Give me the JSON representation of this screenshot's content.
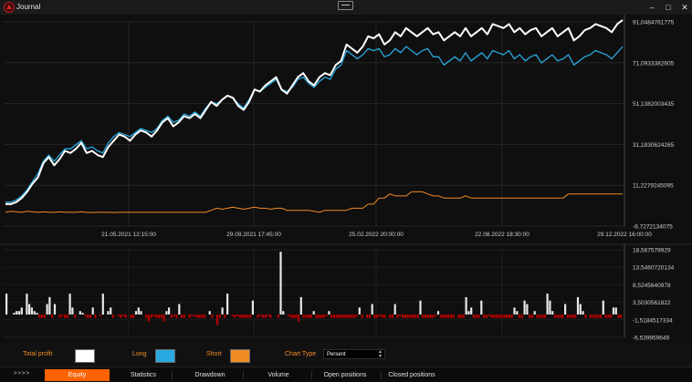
{
  "window": {
    "title": "Journal",
    "icon": "app-logo-icon",
    "controls": [
      "minimize-icon",
      "maximize-icon",
      "close-icon"
    ],
    "minimize_glyph": "–",
    "maximize_glyph": "□",
    "close_glyph": "✕"
  },
  "colors": {
    "background": "#0f0f0f",
    "total_profit": "#ffffff",
    "long": "#29a9e1",
    "short": "#f08b24",
    "volume_positive": "#e8e8e8",
    "volume_negative": "#b00000",
    "active_tab": "#ff6200"
  },
  "chart_data": [
    {
      "type": "line",
      "x_tick_labels": [
        "21.05.2021 12:15:00",
        "29.09.2021 17:45:00",
        "25.02.2022 20:00:00",
        "22.08.2022 18:30:00",
        "29.12.2022 16:00:00"
      ],
      "y_tick_labels": [
        "91,0484761775",
        "71,0933382605",
        "51,1382003435",
        "31,1830624265",
        "11,2279245095",
        "-8,7272134075"
      ],
      "ylim": [
        -8.7272134075,
        91.0484761775
      ],
      "grid": true,
      "series": [
        {
          "name": "Total profit",
          "color": "#ffffff",
          "values": [
            2,
            2,
            3,
            5,
            8,
            12,
            15,
            22,
            25,
            21,
            24,
            28,
            27,
            29,
            32,
            27,
            28,
            26,
            25,
            30,
            33,
            36,
            35,
            33,
            36,
            38,
            37,
            35,
            38,
            42,
            44,
            40,
            42,
            45,
            44,
            46,
            44,
            48,
            52,
            50,
            53,
            55,
            54,
            50,
            48,
            52,
            58,
            57,
            60,
            62,
            64,
            58,
            56,
            60,
            64,
            66,
            62,
            60,
            64,
            66,
            65,
            70,
            72,
            80,
            78,
            76,
            79,
            84,
            83,
            85,
            80,
            82,
            86,
            84,
            88,
            86,
            84,
            86,
            88,
            85,
            86,
            82,
            84,
            86,
            84,
            88,
            84,
            86,
            88,
            85,
            90,
            89,
            88,
            90,
            86,
            88,
            85,
            87,
            88,
            84,
            86,
            88,
            84,
            86,
            88,
            82,
            84,
            87,
            88,
            90,
            89,
            88,
            86,
            90,
            92
          ]
        },
        {
          "name": "Long",
          "color": "#29a9e1",
          "values": [
            3,
            3,
            4,
            6,
            9,
            13,
            17,
            23,
            26,
            23,
            26,
            29,
            29,
            31,
            33,
            29,
            30,
            28,
            27,
            32,
            35,
            37,
            36,
            35,
            37,
            39,
            38,
            37,
            39,
            43,
            45,
            42,
            43,
            46,
            45,
            47,
            45,
            49,
            52,
            51,
            53,
            55,
            54,
            51,
            49,
            53,
            58,
            57,
            59,
            61,
            63,
            58,
            57,
            59,
            63,
            64,
            61,
            59,
            62,
            64,
            63,
            68,
            70,
            77,
            75,
            73,
            75,
            78,
            77,
            78,
            74,
            75,
            78,
            76,
            79,
            77,
            75,
            77,
            78,
            74,
            74,
            70,
            72,
            74,
            72,
            76,
            72,
            74,
            76,
            73,
            77,
            76,
            75,
            77,
            73,
            75,
            72,
            74,
            75,
            71,
            73,
            75,
            72,
            73,
            75,
            70,
            72,
            74,
            75,
            77,
            76,
            75,
            73,
            76,
            79
          ]
        },
        {
          "name": "Short",
          "color": "#f08b24",
          "values": [
            -2,
            -1.5,
            -1.8,
            -2,
            -1.5,
            -1.8,
            -2,
            -1.8,
            -2,
            -2,
            -1.8,
            -1.9,
            -2,
            -2,
            -1.8,
            -2,
            -2.1,
            -2,
            -2,
            -2,
            -2.1,
            -2,
            -2,
            -2,
            -2,
            -2,
            -2,
            -2,
            -2,
            -2,
            -2,
            -2,
            -2,
            -2,
            -2,
            -2,
            -2,
            -2,
            -1,
            0,
            -0.5,
            0,
            0.5,
            0,
            -0.5,
            0,
            0.5,
            0,
            0,
            -0.5,
            0,
            0,
            -1,
            -1,
            -1,
            -1,
            -1,
            -1.5,
            -2,
            -1,
            -1,
            -1,
            -1,
            -1,
            0,
            0,
            0,
            2,
            2,
            5,
            5,
            7,
            6,
            6,
            6,
            8,
            8,
            8,
            7,
            6,
            6,
            5,
            5,
            5,
            5,
            6,
            5,
            5,
            5,
            5,
            5,
            5,
            5,
            5,
            5,
            5,
            5,
            5,
            5,
            5,
            5,
            5,
            5,
            5,
            7,
            7,
            7,
            7,
            7,
            7,
            7,
            7,
            7,
            7,
            7
          ]
        }
      ]
    },
    {
      "type": "bar",
      "y_tick_labels": [
        "18,567579929",
        "13,5460720134",
        "8,5245640978",
        "3,5030561822",
        "-1,5184517334",
        "-6,539959649"
      ],
      "ylim": [
        -6.539959649,
        18.567579929
      ],
      "grid": true,
      "values": [
        6,
        0,
        0,
        0.5,
        1,
        1,
        2,
        0,
        6,
        3,
        2,
        1,
        0.5,
        -1,
        -1,
        -1,
        3,
        5,
        -1,
        3,
        0,
        -1,
        -0.5,
        -1,
        -1,
        6,
        2,
        -1,
        0,
        1,
        0.5,
        -0.5,
        -1,
        -1,
        2,
        -1,
        0,
        -0.5,
        6,
        0,
        1,
        2,
        -1,
        0,
        -0.5,
        -1,
        -0.5,
        -1,
        0,
        -1,
        -1,
        1,
        2,
        1,
        0,
        -1,
        -2,
        -1,
        -0.5,
        -1,
        -1,
        -1,
        -2,
        1,
        2,
        -1,
        -0.5,
        -1,
        3,
        -1,
        -1,
        0,
        -1,
        -0.5,
        -0.5,
        -1,
        -1,
        -1,
        -1,
        0,
        1,
        -1,
        0,
        -3,
        -1,
        2,
        -1,
        6,
        0,
        -0.5,
        -1,
        -0.5,
        -1,
        -1,
        -1,
        -1,
        -1,
        4,
        0,
        -1,
        -0.5,
        -1,
        -1,
        -0.5,
        -1,
        0,
        0,
        -1,
        18,
        1,
        0,
        -0.5,
        -1,
        -1,
        -1,
        -2,
        5,
        -1,
        -1,
        -1,
        -1,
        1,
        -1,
        -1,
        -1,
        -1,
        -0.5,
        1,
        -1,
        -1,
        -1,
        -1,
        -1,
        -1,
        -1,
        -1,
        -1,
        -1,
        -0.5,
        2,
        -1,
        0,
        -1,
        -1,
        3,
        -1,
        -1,
        -0.5,
        -1,
        -1,
        0,
        -1,
        -1,
        3,
        -1,
        -0.5,
        -1,
        -1,
        -1,
        -1,
        -1,
        -1,
        -1,
        4,
        -1,
        -1,
        -1,
        -1,
        -1,
        -0.5,
        1,
        -1,
        -1,
        -1,
        -1,
        -1,
        -1,
        0,
        -1,
        -1,
        -1,
        5,
        1,
        2,
        -1,
        -1,
        -1,
        4,
        -1,
        -1,
        -0.5,
        -1,
        -1,
        -1,
        -1,
        -1,
        -1,
        -1,
        -1,
        -1,
        2,
        1,
        -1,
        -1,
        4,
        3,
        -1,
        -1,
        1,
        -1,
        -1,
        -1,
        -1,
        6,
        4,
        1,
        -1,
        -1,
        -1,
        -1,
        3,
        -1,
        -1,
        -1,
        -1,
        5,
        3,
        1,
        -1,
        0,
        -1,
        -1,
        -1,
        -1,
        -1,
        4,
        -1,
        -1,
        -1,
        2,
        2,
        -1,
        -1
      ]
    }
  ],
  "legend": [
    {
      "label": "Total profit",
      "color": "#ffffff"
    },
    {
      "label": "Long",
      "color": "#29a9e1"
    },
    {
      "label": "Short",
      "color": "#f08b24"
    }
  ],
  "chart_type": {
    "label": "Chart Type",
    "value": "Persent"
  },
  "tabs": {
    "arrows": ">>>>",
    "items": [
      {
        "label": "Equity",
        "active": true
      },
      {
        "label": "Statistics",
        "active": false
      },
      {
        "label": "Drawdown",
        "active": false
      },
      {
        "label": "Volume",
        "active": false
      },
      {
        "label": "Open positions",
        "active": false
      },
      {
        "label": "Closed positions",
        "active": false
      }
    ]
  }
}
